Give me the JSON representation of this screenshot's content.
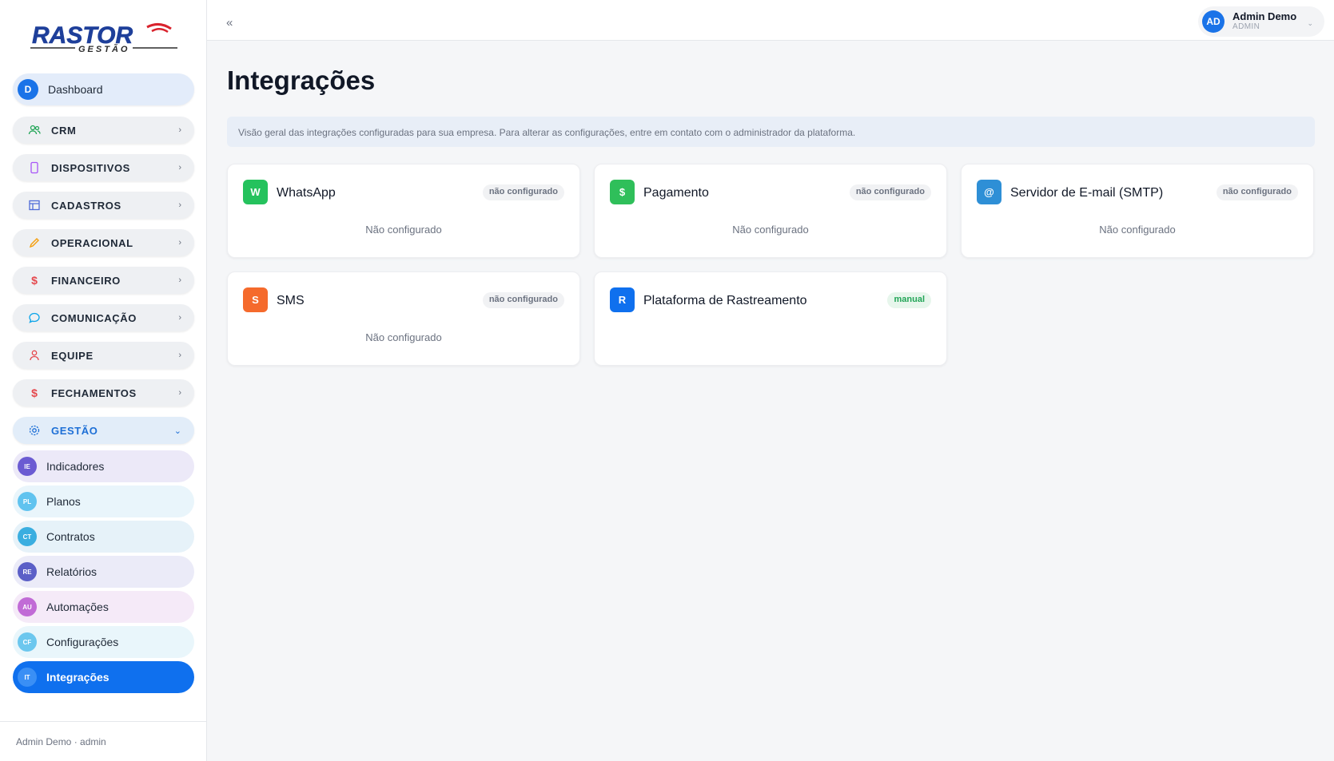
{
  "brand": {
    "name": "RASTOR",
    "sub": "GESTÃO"
  },
  "sidebar": {
    "dashboard": {
      "badge": "D",
      "label": "Dashboard"
    },
    "sections": [
      {
        "label": "CRM",
        "icon": "users-icon",
        "color": "#22a557"
      },
      {
        "label": "DISPOSITIVOS",
        "icon": "phone-icon",
        "color": "#a855f7"
      },
      {
        "label": "CADASTROS",
        "icon": "table-icon",
        "color": "#4f6bd8"
      },
      {
        "label": "OPERACIONAL",
        "icon": "pencil-icon",
        "color": "#f59e0b"
      },
      {
        "label": "FINANCEIRO",
        "icon": "dollar-icon",
        "color": "#e5484d"
      },
      {
        "label": "COMUNICAÇÃO",
        "icon": "chat-icon",
        "color": "#0ea5e9"
      },
      {
        "label": "EQUIPE",
        "icon": "person-icon",
        "color": "#e5484d"
      },
      {
        "label": "FECHAMENTOS",
        "icon": "dollar-icon",
        "color": "#e5484d"
      }
    ],
    "gestao": {
      "label": "GESTÃO",
      "icon": "gear-icon"
    },
    "sub_items": [
      {
        "badge": "IE",
        "label": "Indicadores",
        "color": "#6b5bd2",
        "bg": "#ece9f8"
      },
      {
        "badge": "PL",
        "label": "Planos",
        "color": "#60c3ef",
        "bg": "#e9f5fb"
      },
      {
        "badge": "CT",
        "label": "Contratos",
        "color": "#3aaee0",
        "bg": "#e6f2f9"
      },
      {
        "badge": "RE",
        "label": "Relatórios",
        "color": "#5b5fc7",
        "bg": "#ebebf8"
      },
      {
        "badge": "AU",
        "label": "Automações",
        "color": "#c16bd6",
        "bg": "#f5eaf8"
      },
      {
        "badge": "CF",
        "label": "Configurações",
        "color": "#6cc7ee",
        "bg": "#e9f6fb"
      },
      {
        "badge": "IT",
        "label": "Integrações",
        "color": "#3a8ff5",
        "bg": "#0f70ee"
      }
    ],
    "footer": "Admin Demo · admin"
  },
  "topbar": {
    "collapse": "«",
    "user": {
      "initials": "AD",
      "name": "Admin Demo",
      "role": "ADMIN"
    }
  },
  "main": {
    "title": "Integrações",
    "info": "Visão geral das integrações configuradas para sua empresa. Para alterar as configurações, entre em contato com o administrador da plataforma.",
    "cards": [
      {
        "icon": "W",
        "title": "WhatsApp",
        "status": "não configurado",
        "body": "Não configurado",
        "color": "#25c25d"
      },
      {
        "icon": "$",
        "title": "Pagamento",
        "status": "não configurado",
        "body": "Não configurado",
        "color": "#2fbf5a"
      },
      {
        "icon": "@",
        "title": "Servidor de E-mail (SMTP)",
        "status": "não configurado",
        "body": "Não configurado",
        "color": "#2e8fd6"
      },
      {
        "icon": "S",
        "title": "SMS",
        "status": "não configurado",
        "body": "Não configurado",
        "color": "#f56a2c"
      },
      {
        "icon": "R",
        "title": "Plataforma de Rastreamento",
        "status": "manual",
        "body": "",
        "color": "#0f70ee"
      }
    ]
  }
}
